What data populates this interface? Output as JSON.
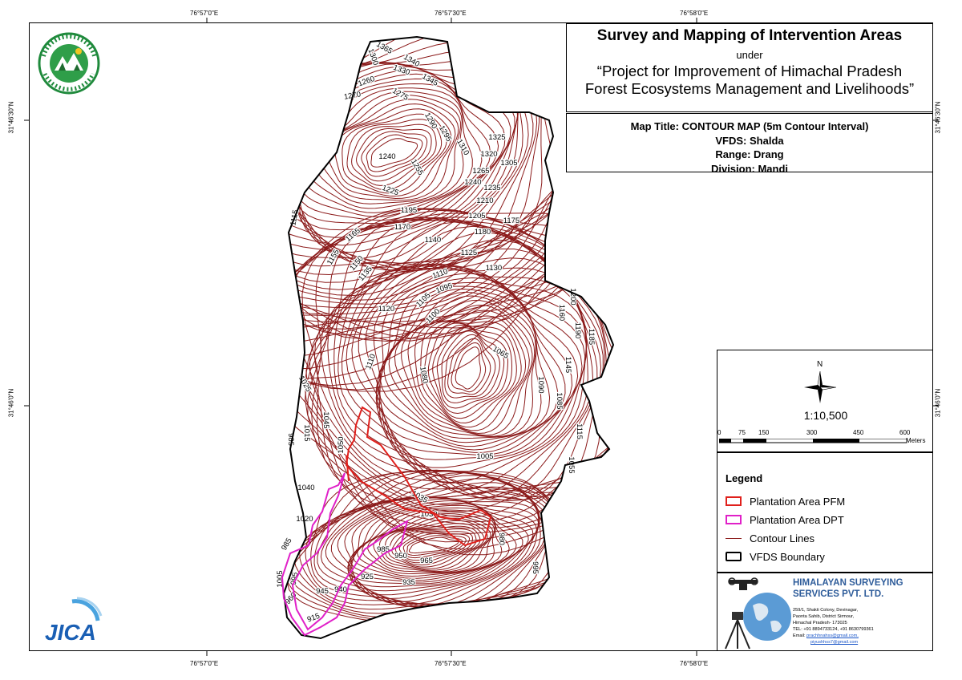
{
  "coordinates": {
    "top_lon": [
      "76°57'0\"E",
      "76°57'30\"E",
      "76°58'0\"E"
    ],
    "bottom_lon": [
      "76°57'0\"E",
      "76°57'30\"E",
      "76°58'0\"E"
    ],
    "left_lat": [
      "31°46'30\"N",
      "31°46'0\"N"
    ],
    "right_lat": [
      "31°46'30\"N",
      "31°46'0\"N"
    ]
  },
  "title": {
    "main": "Survey and Mapping of Intervention Areas",
    "under": "under",
    "project_line1": "“Project for Improvement of Himachal Pradesh",
    "project_line2": "Forest Ecosystems Management and Livelihoods”"
  },
  "info": {
    "map_title": "Map Title: CONTOUR MAP (5m Contour Interval)",
    "vfds": "VFDS: Shalda",
    "range": "Range: Drang",
    "division": "Division: Mandi"
  },
  "scale": {
    "north": "N",
    "ratio": "1:10,500",
    "ticks": [
      "0",
      "75",
      "150",
      "300",
      "450",
      "600"
    ],
    "unit": "Meters"
  },
  "legend": {
    "title": "Legend",
    "items": [
      {
        "label": "Plantation Area PFM",
        "color": "#e0201c",
        "style": "box"
      },
      {
        "label": "Plantation Area DPT",
        "color": "#e020c8",
        "style": "box"
      },
      {
        "label": "Contour Lines",
        "color": "#8b1a1a",
        "style": "line"
      },
      {
        "label": "VFDS Boundary",
        "color": "#000000",
        "style": "box"
      }
    ]
  },
  "company": {
    "name_line1": "HIMALAYAN SURVEYING",
    "name_line2": "SERVICES PVT. LTD.",
    "address": [
      "259/1, Shakti Colony, Devinagar,",
      "Paonta Sahib, District Sirmour,",
      "Himachal Pradesh- 173025"
    ],
    "tel": "TEL: +91 8894733124, +91 8630799361",
    "email_label": "Email:",
    "email1": "prachhnahss@gmail.com,",
    "email2": "piyushhss7@gmail.com"
  },
  "logos": {
    "hp_forest": "hp-forest-department-logo",
    "jica": "JICA"
  },
  "contour_labels": [
    {
      "text": "1365"
    },
    {
      "text": "1300"
    },
    {
      "text": "1340"
    },
    {
      "text": "1330"
    },
    {
      "text": "1345"
    },
    {
      "text": "1260"
    },
    {
      "text": "1275"
    },
    {
      "text": "1270"
    },
    {
      "text": "1290"
    },
    {
      "text": "1295"
    },
    {
      "text": "1310"
    },
    {
      "text": "1325"
    },
    {
      "text": "1255"
    },
    {
      "text": "1320"
    },
    {
      "text": "1240"
    },
    {
      "text": "1305"
    },
    {
      "text": "1265"
    },
    {
      "text": "1240"
    },
    {
      "text": "1235"
    },
    {
      "text": "1225"
    },
    {
      "text": "1210"
    },
    {
      "text": "1195"
    },
    {
      "text": "1205"
    },
    {
      "text": "1175"
    },
    {
      "text": "1115"
    },
    {
      "text": "1170"
    },
    {
      "text": "1180"
    },
    {
      "text": "1165"
    },
    {
      "text": "1140"
    },
    {
      "text": "1155"
    },
    {
      "text": "1150"
    },
    {
      "text": "1125"
    },
    {
      "text": "1130"
    },
    {
      "text": "1135"
    },
    {
      "text": "1110"
    },
    {
      "text": "1095"
    },
    {
      "text": "1105"
    },
    {
      "text": "1200"
    },
    {
      "text": "1120"
    },
    {
      "text": "1100"
    },
    {
      "text": "1160"
    },
    {
      "text": "1190"
    },
    {
      "text": "1185"
    },
    {
      "text": "1065"
    },
    {
      "text": "1145"
    },
    {
      "text": "1110"
    },
    {
      "text": "1080"
    },
    {
      "text": "1090"
    },
    {
      "text": "1025"
    },
    {
      "text": "1085"
    },
    {
      "text": "1045"
    },
    {
      "text": "1015"
    },
    {
      "text": "985"
    },
    {
      "text": "1115"
    },
    {
      "text": "1050"
    },
    {
      "text": "1005"
    },
    {
      "text": "1055"
    },
    {
      "text": "1040"
    },
    {
      "text": "1035"
    },
    {
      "text": "1020"
    },
    {
      "text": "1030"
    },
    {
      "text": "980"
    },
    {
      "text": "985"
    },
    {
      "text": "985"
    },
    {
      "text": "950"
    },
    {
      "text": "965"
    },
    {
      "text": "1005"
    },
    {
      "text": "995"
    },
    {
      "text": "925"
    },
    {
      "text": "935"
    },
    {
      "text": "995"
    },
    {
      "text": "960"
    },
    {
      "text": "945"
    },
    {
      "text": "940"
    },
    {
      "text": "915"
    }
  ]
}
